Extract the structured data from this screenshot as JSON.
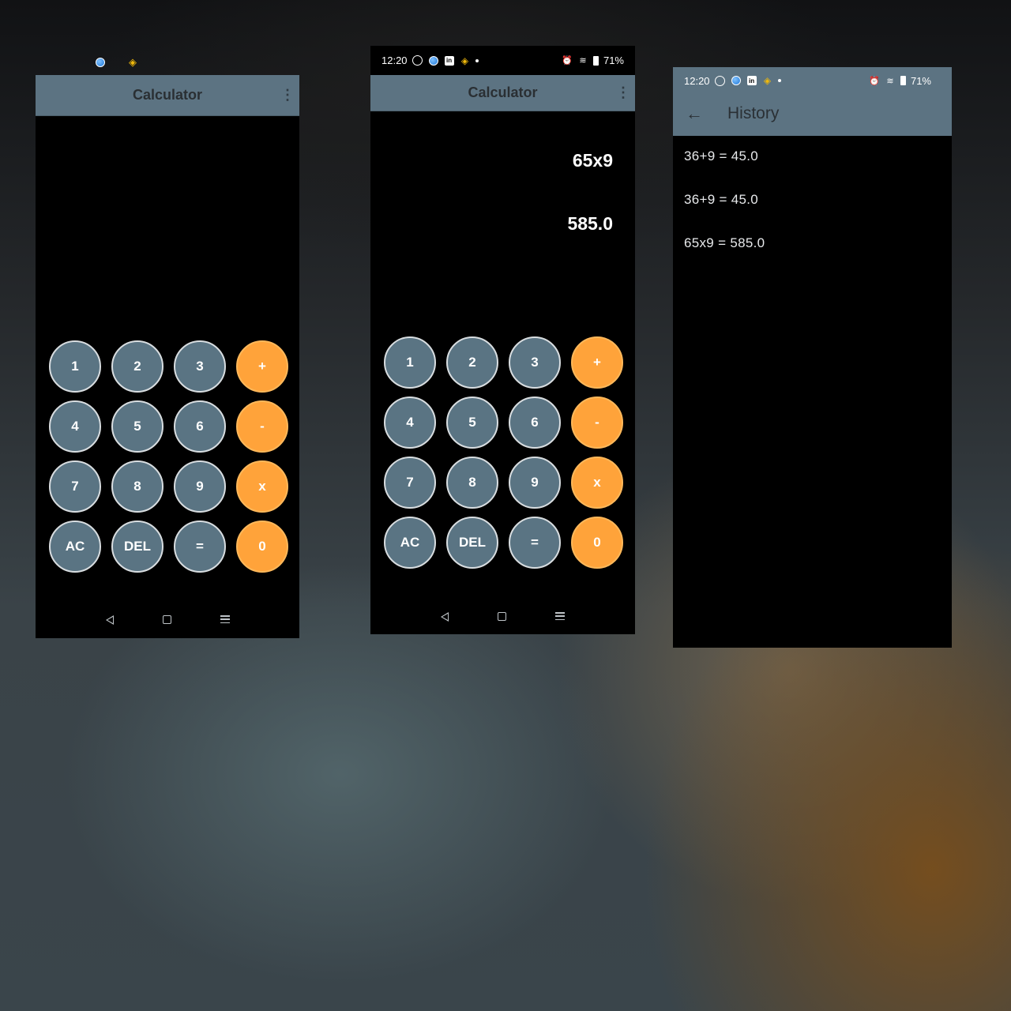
{
  "phone1": {
    "title": "Calculator",
    "keys": [
      "1",
      "2",
      "3",
      "+",
      "4",
      "5",
      "6",
      "-",
      "7",
      "8",
      "9",
      "x",
      "AC",
      "DEL",
      "=",
      "0"
    ]
  },
  "phone2": {
    "status": {
      "time": "12:20",
      "battery": "71%"
    },
    "title": "Calculator",
    "expression": "65x9",
    "result": "585.0",
    "keys": [
      "1",
      "2",
      "3",
      "+",
      "4",
      "5",
      "6",
      "-",
      "7",
      "8",
      "9",
      "x",
      "AC",
      "DEL",
      "=",
      "0"
    ]
  },
  "phone3": {
    "status": {
      "time": "12:20",
      "battery": "71%"
    },
    "title": "History",
    "items": [
      "36+9 = 45.0",
      "36+9 = 45.0",
      "65x9 = 585.0"
    ]
  },
  "icons": {
    "back": "back-arrow-icon",
    "menu": "more-vert-icon"
  },
  "colors": {
    "appbar": "#5c7382",
    "key_number": "#5a7483",
    "key_operator": "#ffa33a",
    "background": "#000000"
  }
}
